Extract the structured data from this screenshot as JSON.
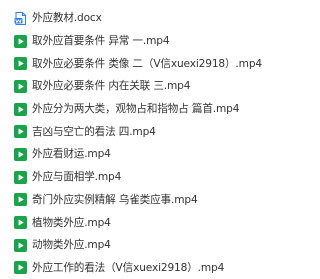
{
  "colors": {
    "video_icon_bg": "#1aa34a",
    "video_icon_fg": "#ffffff",
    "doc_icon_blue": "#2f7ee6",
    "text": "#333333"
  },
  "files": [
    {
      "name": "外应教材.docx",
      "icon": "word-doc-icon"
    },
    {
      "name": "取外应首要条件 异常 一.mp4",
      "icon": "video-file-icon"
    },
    {
      "name": "取外应必要条件 类像 二（V信xuexi2918）.mp4",
      "icon": "video-file-icon"
    },
    {
      "name": "取外应必要条件 内在关联 三.mp4",
      "icon": "video-file-icon"
    },
    {
      "name": "外应分为两大类，观物占和指物占 篇首.mp4",
      "icon": "video-file-icon"
    },
    {
      "name": "吉凶与空亡的看法 四.mp4",
      "icon": "video-file-icon"
    },
    {
      "name": "外应看财运.mp4",
      "icon": "video-file-icon"
    },
    {
      "name": "外应与面相学.mp4",
      "icon": "video-file-icon"
    },
    {
      "name": "奇门外应实例精解 乌雀类应事.mp4",
      "icon": "video-file-icon"
    },
    {
      "name": "植物类外应.mp4",
      "icon": "video-file-icon"
    },
    {
      "name": "动物类外应.mp4",
      "icon": "video-file-icon"
    },
    {
      "name": "外应工作的看法（V信xuexi2918）.mp4",
      "icon": "video-file-icon"
    }
  ]
}
